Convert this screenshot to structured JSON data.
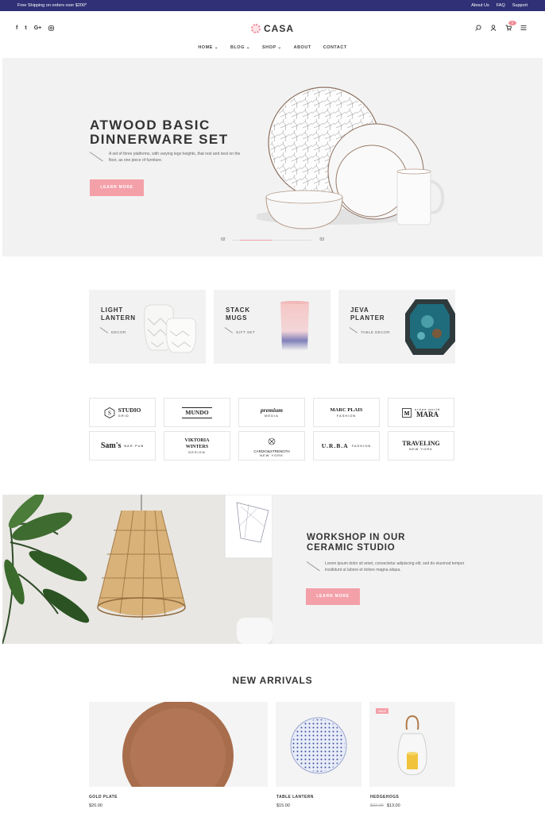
{
  "topbar": {
    "shipping": "Free Shipping on orders over $200*",
    "links": [
      "About Us",
      "FAQ",
      "Support"
    ]
  },
  "social": {
    "items": [
      "f",
      "t",
      "G+",
      "ig"
    ]
  },
  "logo": {
    "text": "CASA"
  },
  "cart": {
    "count": "0"
  },
  "nav": {
    "items": [
      "HOME ⌄",
      "BLOG ⌄",
      "SHOP ⌄",
      "ABOUT",
      "CONTACT"
    ]
  },
  "hero": {
    "title": "ATWOOD BASIC DINNERWARE SET",
    "desc": "A set of three platforms, with varying legs heights, that rest and nest on the floor, as one piece of furniture.",
    "button": "LEARN MORE",
    "slide_prev": "02",
    "slide_next": "03"
  },
  "banners": [
    {
      "title": "LIGHT LANTERN",
      "sub": "DECOR"
    },
    {
      "title": "STACK MUGS",
      "sub": "GIFT SET"
    },
    {
      "title": "JEVA PLANTER",
      "sub": "TABLE DECOR"
    }
  ],
  "brands": [
    {
      "name": "STUDIO",
      "sub": "GRID"
    },
    {
      "name": "MUNDO",
      "sub": ""
    },
    {
      "name": "premium",
      "sub": "MEDIA"
    },
    {
      "name": "MARC PLAIS",
      "sub": "FASHION"
    },
    {
      "name": "MARA",
      "sub": "urban world"
    },
    {
      "name": "Sam's",
      "sub": "BAR·PUB"
    },
    {
      "name": "VIKTORIA WINTERS",
      "sub": "DESIGN"
    },
    {
      "name": "CARDIO&STRENGTH",
      "sub": "NEW YORK"
    },
    {
      "name": "U.R.B.A",
      "sub": "FASHION"
    },
    {
      "name": "TRAVELING",
      "sub": "NEW YORK"
    }
  ],
  "workshop": {
    "title": "WORKSHOP IN OUR CERAMIC STUDIO",
    "desc": "Lorem ipsum dolor sit amet, consectetur adipiscing elit, sed do eiusmod tempor incididunt ut labore et dolore magna aliqua.",
    "button": "LEARN MORE"
  },
  "new_arrivals": {
    "title": "NEW ARRIVALS",
    "products": [
      {
        "name": "GOLD PLATE",
        "price": "$20.00"
      },
      {
        "name": "TABLE LANTERN",
        "price": "$15.00"
      },
      {
        "name": "HEDGEHOGS",
        "old_price": "$32.00",
        "price": "$13.00",
        "badge": "SALE"
      }
    ]
  },
  "colors": {
    "topbar": "#2f3075",
    "accent": "#f4a0a9",
    "panel": "#f2f2f2"
  }
}
